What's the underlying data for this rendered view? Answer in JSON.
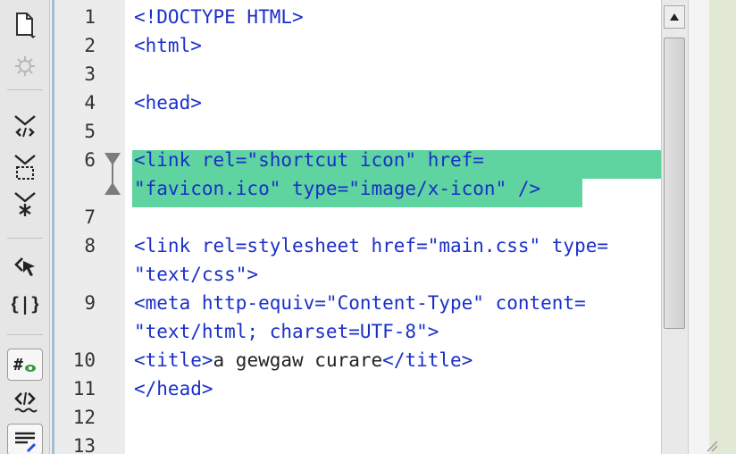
{
  "toolbar": {
    "tools": [
      {
        "name": "new-file-icon"
      },
      {
        "name": "debug-gear-icon"
      },
      {
        "name": "collapse-full-tag-icon"
      },
      {
        "name": "collapse-selection-icon"
      },
      {
        "name": "expand-all-icon"
      },
      {
        "name": "select-parent-tag-icon"
      },
      {
        "name": "balance-braces-icon"
      },
      {
        "name": "line-numbers-icon"
      },
      {
        "name": "highlight-invalid-code-icon"
      },
      {
        "name": "apply-comment-icon"
      }
    ]
  },
  "editor": {
    "lines": [
      {
        "num": "1",
        "segments": [
          {
            "text": "<!DOCTYPE HTML>",
            "kind": "tag"
          }
        ]
      },
      {
        "num": "2",
        "segments": [
          {
            "text": "<html>",
            "kind": "tag"
          }
        ]
      },
      {
        "num": "3",
        "segments": []
      },
      {
        "num": "4",
        "segments": [
          {
            "text": "<head>",
            "kind": "tag"
          }
        ]
      },
      {
        "num": "5",
        "segments": []
      },
      {
        "num": "6",
        "highlighted": true,
        "segments": [
          {
            "text": "<link rel=\"shortcut icon\" href=",
            "kind": "tag"
          }
        ]
      },
      {
        "num": "",
        "highlighted": true,
        "segments": [
          {
            "text": "\"favicon.ico\" type=\"image/x-icon\" />",
            "kind": "tag"
          }
        ]
      },
      {
        "num": "7",
        "segments": []
      },
      {
        "num": "8",
        "segments": [
          {
            "text": "<link rel=stylesheet href=\"main.css\" type=",
            "kind": "tag"
          }
        ]
      },
      {
        "num": "",
        "segments": [
          {
            "text": "\"text/css\">",
            "kind": "tag"
          }
        ]
      },
      {
        "num": "9",
        "segments": [
          {
            "text": "<meta http-equiv=\"Content-Type\" content=",
            "kind": "tag"
          }
        ]
      },
      {
        "num": "",
        "segments": [
          {
            "text": "\"text/html; charset=UTF-8\">",
            "kind": "tag"
          }
        ]
      },
      {
        "num": "10",
        "segments": [
          {
            "text": "<title>",
            "kind": "tag"
          },
          {
            "text": "a gewgaw curare",
            "kind": "text"
          },
          {
            "text": "</title>",
            "kind": "tag"
          }
        ]
      },
      {
        "num": "11",
        "segments": [
          {
            "text": "</head>",
            "kind": "tag"
          }
        ]
      },
      {
        "num": "12",
        "segments": []
      },
      {
        "num": "13",
        "segments": []
      }
    ]
  },
  "colors": {
    "tag": "#1a2fc8",
    "text": "#222222",
    "highlight": "#5fd3a0",
    "line_number": "#333333"
  }
}
